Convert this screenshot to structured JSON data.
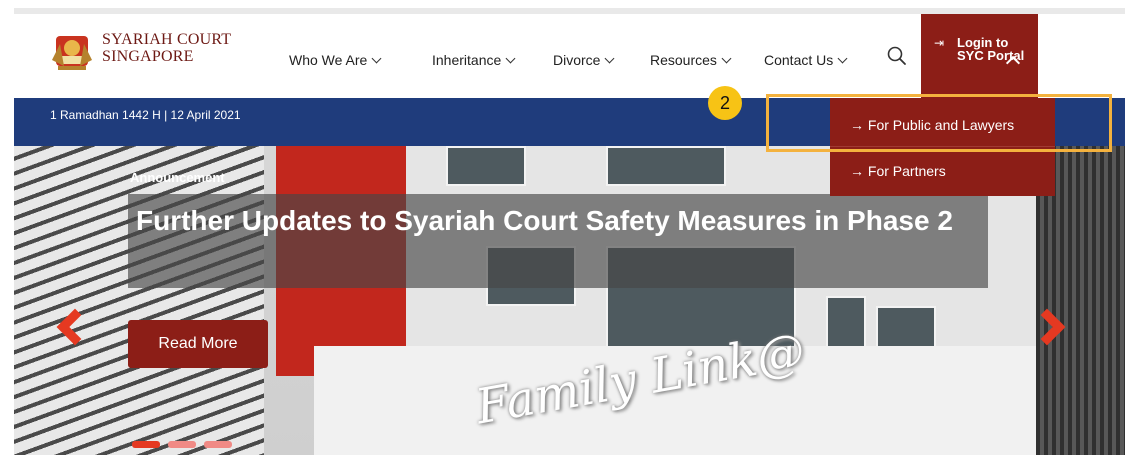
{
  "header": {
    "logo_line1": "SYARIAH COURT",
    "logo_line2": "SINGAPORE",
    "nav": [
      {
        "label": "Who We Are"
      },
      {
        "label": "Inheritance"
      },
      {
        "label": "Divorce"
      },
      {
        "label": "Resources"
      },
      {
        "label": "Contact Us"
      }
    ],
    "search_icon": "search-icon",
    "login": {
      "line1": "Login to",
      "line2": "SYC Portal",
      "icon": "login-arrow-icon"
    }
  },
  "date_bar": {
    "text": "1 Ramadhan 1442 H | 12 April 2021"
  },
  "hero": {
    "tag": "Announcement",
    "headline": "Further Updates to Syariah Court Safety Measures in Phase 2",
    "button_label": "Read More",
    "sign_text": "Family Link@",
    "slides": {
      "count": 3,
      "active_index": 0
    }
  },
  "dropdown": {
    "items": [
      {
        "label": "→ For Public and Lawyers"
      },
      {
        "label": "→ For Partners"
      }
    ]
  },
  "annotation": {
    "step": "2"
  },
  "colors": {
    "brand_red": "#8c1e17",
    "date_bar_blue": "#1f3c7c",
    "arrow_red": "#e53921",
    "highlight": "#f4b23e",
    "badge": "#f7c315"
  }
}
